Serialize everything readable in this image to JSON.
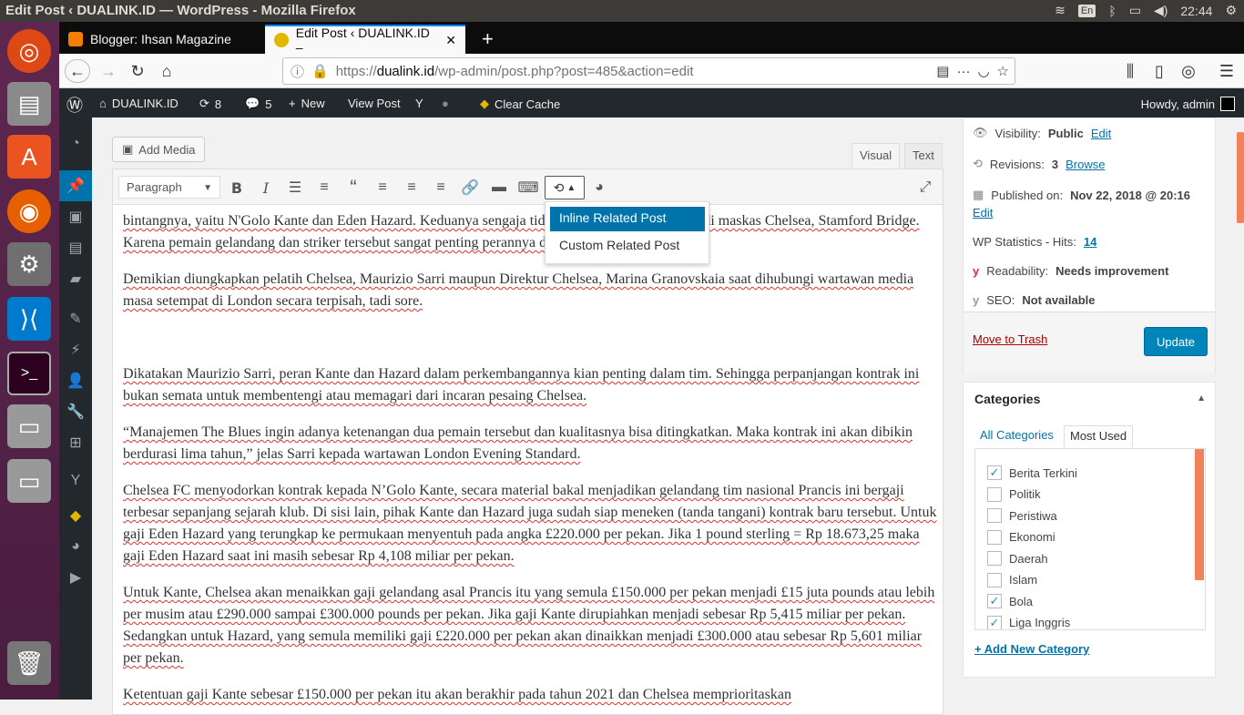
{
  "os_bar": {
    "title": "Edit Post ‹ DUALINK.ID — WordPress - Mozilla Firefox",
    "lang": "En",
    "time": "22:44"
  },
  "browser": {
    "tabs": [
      {
        "label": "Blogger: Ihsan Magazine"
      },
      {
        "label": "Edit Post ‹ DUALINK.ID –"
      }
    ],
    "url_prefix": "https://",
    "url_host": "dualink.id",
    "url_path": "/wp-admin/post.php?post=485&action=edit"
  },
  "adminbar": {
    "site": "DUALINK.ID",
    "updates": "8",
    "comments": "5",
    "new": "New",
    "view_post": "View Post",
    "clear_cache": "Clear Cache",
    "howdy": "Howdy, admin"
  },
  "editor": {
    "add_media": "Add Media",
    "tab_visual": "Visual",
    "tab_text": "Text",
    "format": "Paragraph",
    "dropdown": [
      "Inline Related Post",
      "Custom Related Post"
    ],
    "paragraphs": [
      "bintangnya, yaitu N'Golo Kante dan Eden Hazard. Keduanya sengaja tidak dilepas agar tetap betah di maskas Chelsea, Stamford Bridge. Karena pemain gelandang dan striker tersebut sangat penting perannya dalam tim.",
      "Demikian diungkapkan pelatih Chelsea, Maurizio Sarri maupun Direktur Chelsea, Marina Granovskaia saat dihubungi wartawan media masa setempat di London secara terpisah, tadi sore.",
      "Dikatakan Maurizio Sarri, peran Kante dan Hazard dalam perkembangannya kian penting dalam tim. Sehingga perpanjangan kontrak ini bukan semata untuk membentengi atau memagari dari incaran pesaing Chelsea.",
      "“Manajemen The Blues ingin adanya ketenangan dua pemain tersebut dan kualitasnya bisa ditingkatkan. Maka kontrak ini akan dibikin berdurasi lima tahun,” jelas Sarri kepada wartawan London Evening Standard.",
      "Chelsea FC menyodorkan kontrak kepada N’Golo Kante, secara material bakal menjadikan gelandang tim nasional Prancis ini bergaji terbesar sepanjang sejarah klub. Di sisi lain, pihak Kante dan Hazard juga sudah siap meneken (tanda tangani) kontrak baru tersebut. Untuk gaji Eden Hazard yang terungkap ke permukaan menyentuh pada angka £220.000 per pekan.  Jika 1 pound sterling = Rp 18.673,25 maka gaji Eden Hazard saat ini masih sebesar Rp 4,108 miliar per pekan.",
      "Untuk Kante, Chelsea akan menaikkan gaji gelandang asal Prancis itu yang semula £150.000 per pekan menjadi £15 juta pounds atau lebih per musim atau £290.000 sampai £300.000 pounds per pekan. Jika gaji Kante dirupiahkan menjadi sebesar Rp 5,415 miliar per pekan. Sedangkan untuk Hazard, yang semula memiliki gaji £220.000 per pekan akan dinaikkan menjadi £300.000 atau sebesar Rp 5,601 miliar per pekan.",
      "Ketentuan gaji Kante sebesar £150.000 per pekan itu akan berakhir pada tahun 2021 dan Chelsea memprioritaskan"
    ]
  },
  "publish": {
    "visibility_label": "Visibility:",
    "visibility_value": "Public",
    "edit": "Edit",
    "revisions_label": "Revisions:",
    "revisions_value": "3",
    "browse": "Browse",
    "published_label": "Published on:",
    "published_value": "Nov 22, 2018 @ 20:16",
    "stats_label": "WP Statistics - Hits:",
    "stats_value": "14",
    "readability_label": "Readability:",
    "readability_value": "Needs improvement",
    "seo_label": "SEO:",
    "seo_value": "Not available",
    "trash": "Move to Trash",
    "update": "Update"
  },
  "categories": {
    "title": "Categories",
    "tab_all": "All Categories",
    "tab_used": "Most Used",
    "items": [
      {
        "name": "Berita Terkini",
        "checked": true
      },
      {
        "name": "Politik",
        "checked": false
      },
      {
        "name": "Peristiwa",
        "checked": false
      },
      {
        "name": "Ekonomi",
        "checked": false
      },
      {
        "name": "Daerah",
        "checked": false
      },
      {
        "name": "Islam",
        "checked": false
      },
      {
        "name": "Bola",
        "checked": true
      },
      {
        "name": "Liga Inggris",
        "checked": true
      }
    ],
    "add_new": "+ Add New Category"
  },
  "colors": {
    "wp_blue": "#0073aa",
    "admin_dark": "#23282d",
    "ubuntu_purple": "#5e2750"
  }
}
